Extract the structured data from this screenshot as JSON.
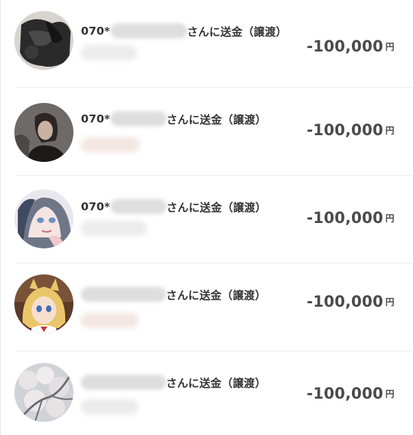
{
  "transactions": [
    {
      "name_prefix": "070*",
      "recipient_suffix": "さんに送金（譲渡）",
      "amount": "-100,000",
      "currency": "円",
      "avatar": "dark-clothing-photo"
    },
    {
      "name_prefix": "070*",
      "recipient_suffix": "さんに送金（譲渡）",
      "amount": "-100,000",
      "currency": "円",
      "avatar": "woman-portrait-photo"
    },
    {
      "name_prefix": "070*",
      "recipient_suffix": "さんに送金（譲渡）",
      "amount": "-100,000",
      "currency": "円",
      "avatar": "anime-girl-illustration"
    },
    {
      "name_prefix": "",
      "recipient_suffix": "さんに送金（譲渡）",
      "amount": "-100,000",
      "currency": "円",
      "avatar": "anime-blonde-illustration"
    },
    {
      "name_prefix": "",
      "recipient_suffix": "さんに送金（譲渡）",
      "amount": "-100,000",
      "currency": "円",
      "avatar": "cherry-blossom-photo"
    }
  ]
}
